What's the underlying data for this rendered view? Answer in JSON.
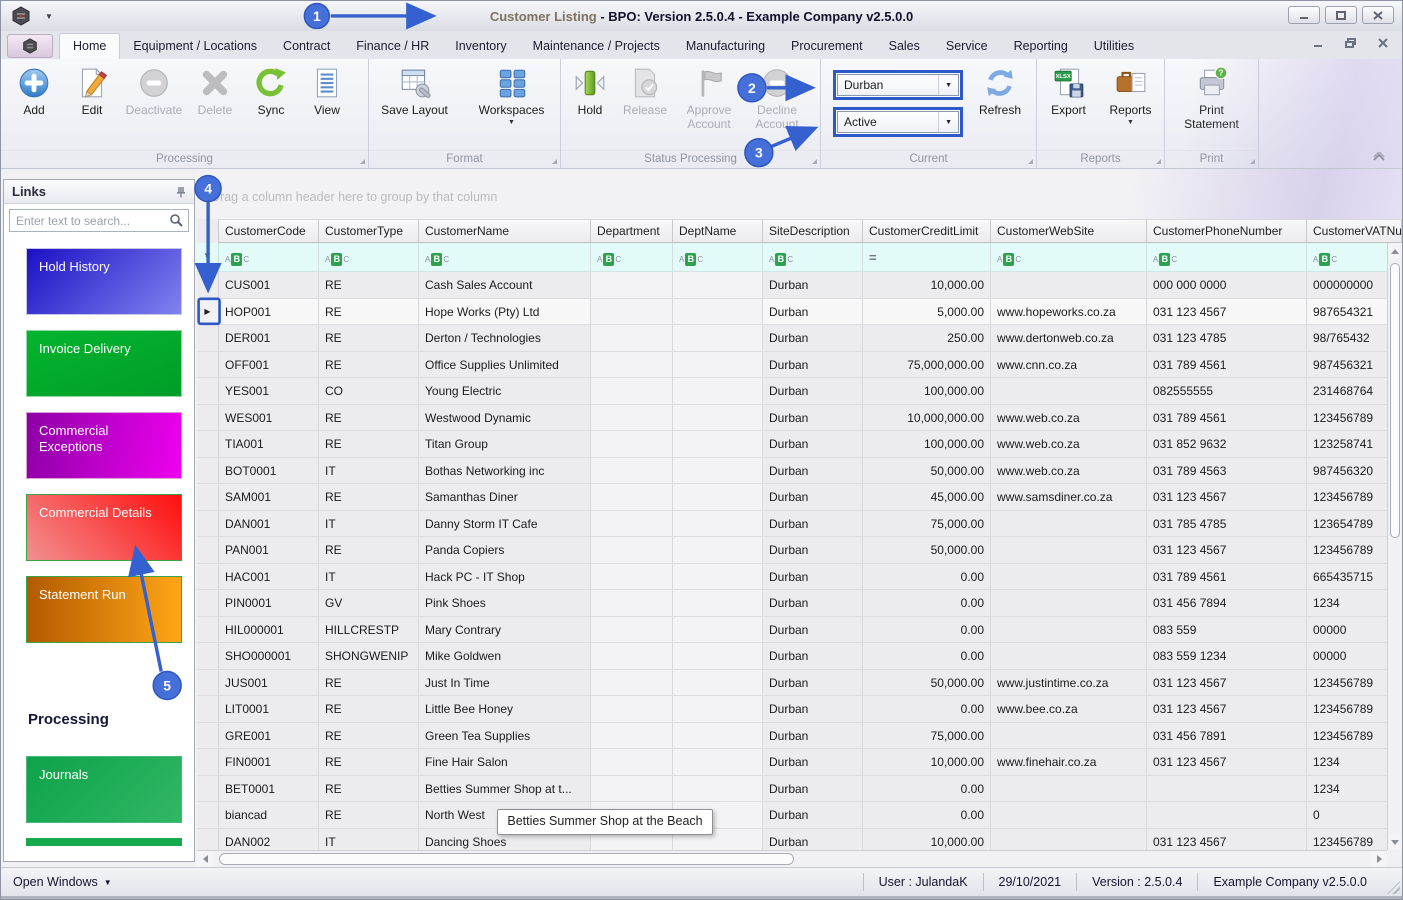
{
  "titlebar": {
    "title_name": "Customer Listing",
    "title_rest": " - BPO: Version 2.5.0.4 - Example Company v2.5.0.0"
  },
  "ribbon": {
    "tabs": [
      "Home",
      "Equipment / Locations",
      "Contract",
      "Finance / HR",
      "Inventory",
      "Maintenance / Projects",
      "Manufacturing",
      "Procurement",
      "Sales",
      "Service",
      "Reporting",
      "Utilities"
    ],
    "active_tab": "Home",
    "groups": {
      "processing": {
        "label": "Processing",
        "add": "Add",
        "edit": "Edit",
        "deactivate": "Deactivate",
        "delete": "Delete",
        "sync": "Sync",
        "view": "View"
      },
      "format": {
        "label": "Format",
        "save_layout": "Save Layout",
        "workspaces": "Workspaces"
      },
      "status_processing": {
        "label": "Status Processing",
        "hold": "Hold",
        "release": "Release",
        "approve": "Approve Account",
        "decline": "Decline Account"
      },
      "current": {
        "label": "Current",
        "site": "Durban",
        "status": "Active",
        "refresh": "Refresh"
      },
      "reports": {
        "label": "Reports",
        "export": "Export",
        "reports": "Reports"
      },
      "print": {
        "label": "Print",
        "print_statement": "Print Statement"
      }
    },
    "icons": {
      "export_badge": "XLSX",
      "print_badge": "?"
    }
  },
  "sidebar": {
    "title": "Links",
    "search_placeholder": "Enter text to search...",
    "links": [
      {
        "label": "Hold History",
        "c1": "#1c10c4",
        "c2": "#8282f0",
        "angle": 135,
        "border": "#c6c6e6"
      },
      {
        "label": "Invoice Delivery",
        "c1": "#04b42f",
        "c2": "#009e27",
        "angle": 160,
        "border": "#8fd89f"
      },
      {
        "label": "Commercial Exceptions",
        "c1": "#8d00a6",
        "c2": "#ef00ef",
        "angle": 100,
        "border": "#d8a0d8"
      },
      {
        "label": "Commercial Details",
        "c1": "#ff0e0e",
        "c2": "#f39090",
        "angle": 225,
        "border": "#3aa348"
      },
      {
        "label": "Statement Run",
        "c1": "#b25a00",
        "c2": "#ffa617",
        "angle": 90,
        "border": "#3aa348"
      }
    ],
    "section_title": "Processing",
    "processing_links": [
      {
        "label": "Journals",
        "c1": "#0ea24a",
        "c2": "#31b765",
        "angle": 135,
        "border": "#49b878"
      }
    ],
    "partial_link_color": "#16aa4e"
  },
  "grid": {
    "group_hint": "Drag a column header here to group by that column",
    "filter_letters": {
      "a": "A",
      "b": "B",
      "c": "C",
      "eq": "="
    },
    "row_indicator": "▶",
    "filter_indicator": "*",
    "columns": [
      "CustomerCode",
      "CustomerType",
      "CustomerName",
      "Department",
      "DeptName",
      "SiteDescription",
      "CustomerCreditLimit",
      "CustomerWebSite",
      "CustomerPhoneNumber",
      "CustomerVATNumber"
    ],
    "selected_row": 1,
    "tooltip": "Betties Summer Shop at the Beach",
    "rows": [
      [
        "CUS001",
        "RE",
        "Cash Sales Account",
        "",
        "",
        "Durban",
        "10,000.00",
        "",
        "000 000 0000",
        "000000000"
      ],
      [
        "HOP001",
        "RE",
        "Hope Works (Pty) Ltd",
        "",
        "",
        "Durban",
        "5,000.00",
        "www.hopeworks.co.za",
        "031 123 4567",
        "987654321"
      ],
      [
        "DER001",
        "RE",
        "Derton / Technologies",
        "",
        "",
        "Durban",
        "250.00",
        "www.dertonweb.co.za",
        "031 123 4785",
        "98/765432"
      ],
      [
        "OFF001",
        "RE",
        "Office Supplies Unlimited",
        "",
        "",
        "Durban",
        "75,000,000.00",
        "www.cnn.co.za",
        "031 789 4561",
        "987456321"
      ],
      [
        "YES001",
        "CO",
        "Young Electric",
        "",
        "",
        "Durban",
        "100,000.00",
        "",
        "082555555",
        "231468764"
      ],
      [
        "WES001",
        "RE",
        "Westwood Dynamic",
        "",
        "",
        "Durban",
        "10,000,000.00",
        "www.web.co.za",
        "031 789 4561",
        "123456789"
      ],
      [
        "TIA001",
        "RE",
        "Titan Group",
        "",
        "",
        "Durban",
        "100,000.00",
        "www.web.co.za",
        "031 852 9632",
        "123258741"
      ],
      [
        "BOT0001",
        "IT",
        "Bothas Networking inc",
        "",
        "",
        "Durban",
        "50,000.00",
        "www.web.co.za",
        "031 789 4563",
        "987456320"
      ],
      [
        "SAM001",
        "RE",
        "Samanthas Diner",
        "",
        "",
        "Durban",
        "45,000.00",
        "www.samsdiner.co.za",
        "031 123 4567",
        "123456789"
      ],
      [
        "DAN001",
        "IT",
        "Danny Storm IT Cafe",
        "",
        "",
        "Durban",
        "75,000.00",
        "",
        "031 785 4785",
        "123654789"
      ],
      [
        "PAN001",
        "RE",
        "Panda Copiers",
        "",
        "",
        "Durban",
        "50,000.00",
        "",
        "031 123 4567",
        "123456789"
      ],
      [
        "HAC001",
        "IT",
        "Hack PC - IT Shop",
        "",
        "",
        "Durban",
        "0.00",
        "",
        "031 789 4561",
        "665435715"
      ],
      [
        "PIN0001",
        "GV",
        "Pink Shoes",
        "",
        "",
        "Durban",
        "0.00",
        "",
        "031 456 7894",
        "1234"
      ],
      [
        "HIL000001",
        "HILLCRESTP",
        "Mary Contrary",
        "",
        "",
        "Durban",
        "0.00",
        "",
        "083 559",
        "00000"
      ],
      [
        "SHO000001",
        "SHONGWENIP",
        "Mike Goldwen",
        "",
        "",
        "Durban",
        "0.00",
        "",
        "083 559 1234",
        "00000"
      ],
      [
        "JUS001",
        "RE",
        "Just In Time",
        "",
        "",
        "Durban",
        "50,000.00",
        "www.justintime.co.za",
        "031 123 4567",
        "123456789"
      ],
      [
        "LIT0001",
        "RE",
        "Little Bee Honey",
        "",
        "",
        "Durban",
        "0.00",
        "www.bee.co.za",
        "031 123 4567",
        "123456789"
      ],
      [
        "GRE001",
        "RE",
        "Green Tea Supplies",
        "",
        "",
        "Durban",
        "75,000.00",
        "",
        "031 456 7891",
        "123456789"
      ],
      [
        "FIN0001",
        "RE",
        "Fine Hair Salon",
        "",
        "",
        "Durban",
        "10,000.00",
        "www.finehair.co.za",
        "031 123 4567",
        "1234"
      ],
      [
        "BET0001",
        "RE",
        "Betties Summer Shop at t...",
        "",
        "",
        "Durban",
        "0.00",
        "",
        "",
        "1234"
      ],
      [
        "biancad",
        "RE",
        "North West",
        "",
        "",
        "Durban",
        "0.00",
        "",
        "",
        "0"
      ],
      [
        "DAN002",
        "IT",
        "Dancing Shoes",
        "",
        "",
        "Durban",
        "10,000.00",
        "",
        "031 123 4567",
        "123456789"
      ]
    ]
  },
  "statusbar": {
    "open_windows": "Open Windows",
    "user": "User : JulandaK",
    "date": "29/10/2021",
    "version": "Version : 2.5.0.4",
    "company": "Example Company v2.5.0.0"
  },
  "callouts": {
    "n1": "1",
    "n2": "2",
    "n3": "3",
    "n4": "4",
    "n5": "5"
  }
}
